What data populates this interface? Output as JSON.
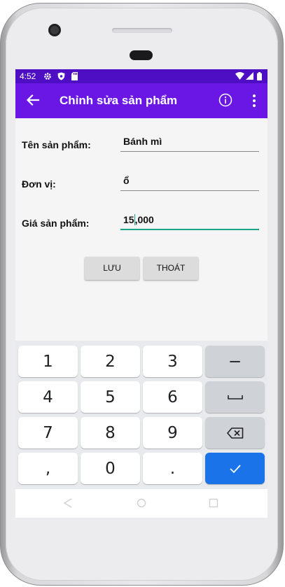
{
  "status_bar": {
    "time": "4:52",
    "icons": [
      "gear-icon",
      "shield-icon",
      "sd-card-icon",
      "wifi-icon",
      "signal-icon",
      "battery-icon"
    ]
  },
  "app_bar": {
    "title": "Chỉnh sửa sản phẩm",
    "back_icon": "arrow-back-icon",
    "info_icon": "info-icon",
    "more_icon": "more-vert-icon"
  },
  "form": {
    "name_label": "Tên sản phẩm:",
    "name_value": "Bánh mì",
    "unit_label": "Đơn vị:",
    "unit_value": "ổ",
    "price_label": "Giá sản phẩm:",
    "price_value_before_cursor": "15",
    "price_value_after_cursor": ",000"
  },
  "buttons": {
    "save": "LƯU",
    "exit": "THOÁT"
  },
  "keyboard": {
    "row1": [
      "1",
      "2",
      "3",
      "−"
    ],
    "row2": [
      "4",
      "5",
      "6",
      "space-icon"
    ],
    "row3": [
      "7",
      "8",
      "9",
      "backspace-icon"
    ],
    "row4": [
      ",",
      "0",
      ".",
      "check-icon"
    ]
  },
  "colors": {
    "status_bar": "#4e0fc4",
    "app_bar": "#6a17e6",
    "focus_underline": "#19a58a",
    "enter_key": "#1a73e8"
  }
}
